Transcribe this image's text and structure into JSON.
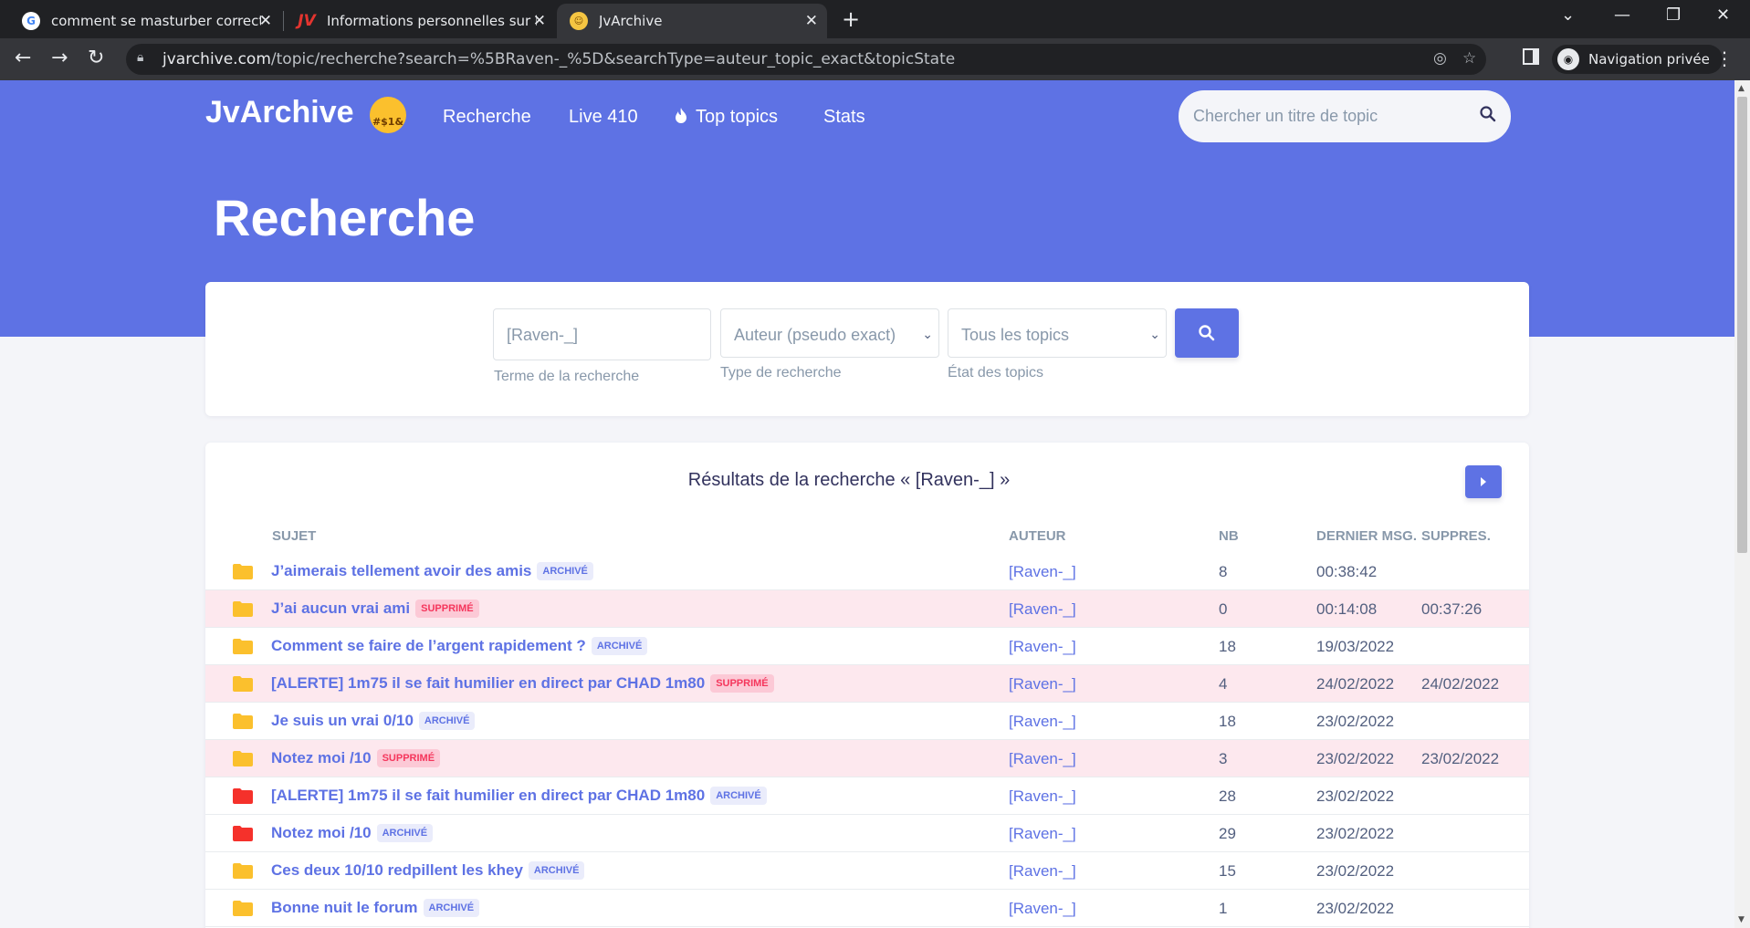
{
  "browser": {
    "tabs": [
      {
        "title": "comment se masturber correctem",
        "favicon": "google-icon"
      },
      {
        "title": "Informations personnelles sur le p",
        "favicon": "jv-icon"
      },
      {
        "title": "JvArchive",
        "favicon": "emoji-icon"
      }
    ],
    "url_domain": "jvarchive.com",
    "url_path": "/topic/recherche?search=%5BRaven-_%5D&searchType=auteur_topic_exact&topicState",
    "private_label": "Navigation privée"
  },
  "site": {
    "brand": "JvArchive",
    "brand_emoji_text": "#$1&",
    "nav": [
      "Recherche",
      "Live 410",
      "Top topics",
      "Stats"
    ],
    "search_placeholder": "Chercher un titre de topic"
  },
  "page_title": "Recherche",
  "search_form": {
    "term_value": "[Raven-_]",
    "term_hint": "Terme de la recherche",
    "type_value": "Auteur (pseudo exact)",
    "type_hint": "Type de recherche",
    "state_value": "Tous les topics",
    "state_hint": "État des topics"
  },
  "results": {
    "title": "Résultats de la recherche « [Raven-_] »",
    "headers": {
      "subject": "Sujet",
      "author": "Auteur",
      "nb": "NB",
      "last": "Dernier msg.",
      "deleted": "Suppres."
    },
    "rows": [
      {
        "subject": "J’aimerais tellement avoir des amis",
        "badge": "ARCHIVÉ",
        "status": "archive",
        "folder_color": "#fbc02d",
        "author": "[Raven-_]",
        "nb": "8",
        "last": "00:38:42",
        "deleted": ""
      },
      {
        "subject": "J’ai aucun vrai ami",
        "badge": "SUPPRIMÉ",
        "status": "supp",
        "folder_color": "#fbc02d",
        "author": "[Raven-_]",
        "nb": "0",
        "last": "00:14:08",
        "deleted": "00:37:26"
      },
      {
        "subject": "Comment se faire de l’argent rapidement ?",
        "badge": "ARCHIVÉ",
        "status": "archive",
        "folder_color": "#fbc02d",
        "author": "[Raven-_]",
        "nb": "18",
        "last": "19/03/2022",
        "deleted": ""
      },
      {
        "subject": "[ALERTE] 1m75 il se fait humilier en direct par CHAD 1m80",
        "badge": "SUPPRIMÉ",
        "status": "supp",
        "folder_color": "#fbc02d",
        "author": "[Raven-_]",
        "nb": "4",
        "last": "24/02/2022",
        "deleted": "24/02/2022"
      },
      {
        "subject": "Je suis un vrai 0/10",
        "badge": "ARCHIVÉ",
        "status": "archive",
        "folder_color": "#fbc02d",
        "author": "[Raven-_]",
        "nb": "18",
        "last": "23/02/2022",
        "deleted": ""
      },
      {
        "subject": "Notez moi /10",
        "badge": "SUPPRIMÉ",
        "status": "supp",
        "folder_color": "#fbc02d",
        "author": "[Raven-_]",
        "nb": "3",
        "last": "23/02/2022",
        "deleted": "23/02/2022"
      },
      {
        "subject": "[ALERTE] 1m75 il se fait humilier en direct par CHAD 1m80",
        "badge": "ARCHIVÉ",
        "status": "archive",
        "folder_color": "#f5312b",
        "author": "[Raven-_]",
        "nb": "28",
        "last": "23/02/2022",
        "deleted": ""
      },
      {
        "subject": "Notez moi /10",
        "badge": "ARCHIVÉ",
        "status": "archive",
        "folder_color": "#f5312b",
        "author": "[Raven-_]",
        "nb": "29",
        "last": "23/02/2022",
        "deleted": ""
      },
      {
        "subject": "Ces deux 10/10 redpillent les khey",
        "badge": "ARCHIVÉ",
        "status": "archive",
        "folder_color": "#fbc02d",
        "author": "[Raven-_]",
        "nb": "15",
        "last": "23/02/2022",
        "deleted": ""
      },
      {
        "subject": "Bonne nuit le forum",
        "badge": "ARCHIVÉ",
        "status": "archive",
        "folder_color": "#fbc02d",
        "author": "[Raven-_]",
        "nb": "1",
        "last": "23/02/2022",
        "deleted": ""
      }
    ]
  },
  "colors": {
    "accent": "#5e72e4",
    "deleted_row": "#fde8ee",
    "danger": "#f5365c"
  }
}
